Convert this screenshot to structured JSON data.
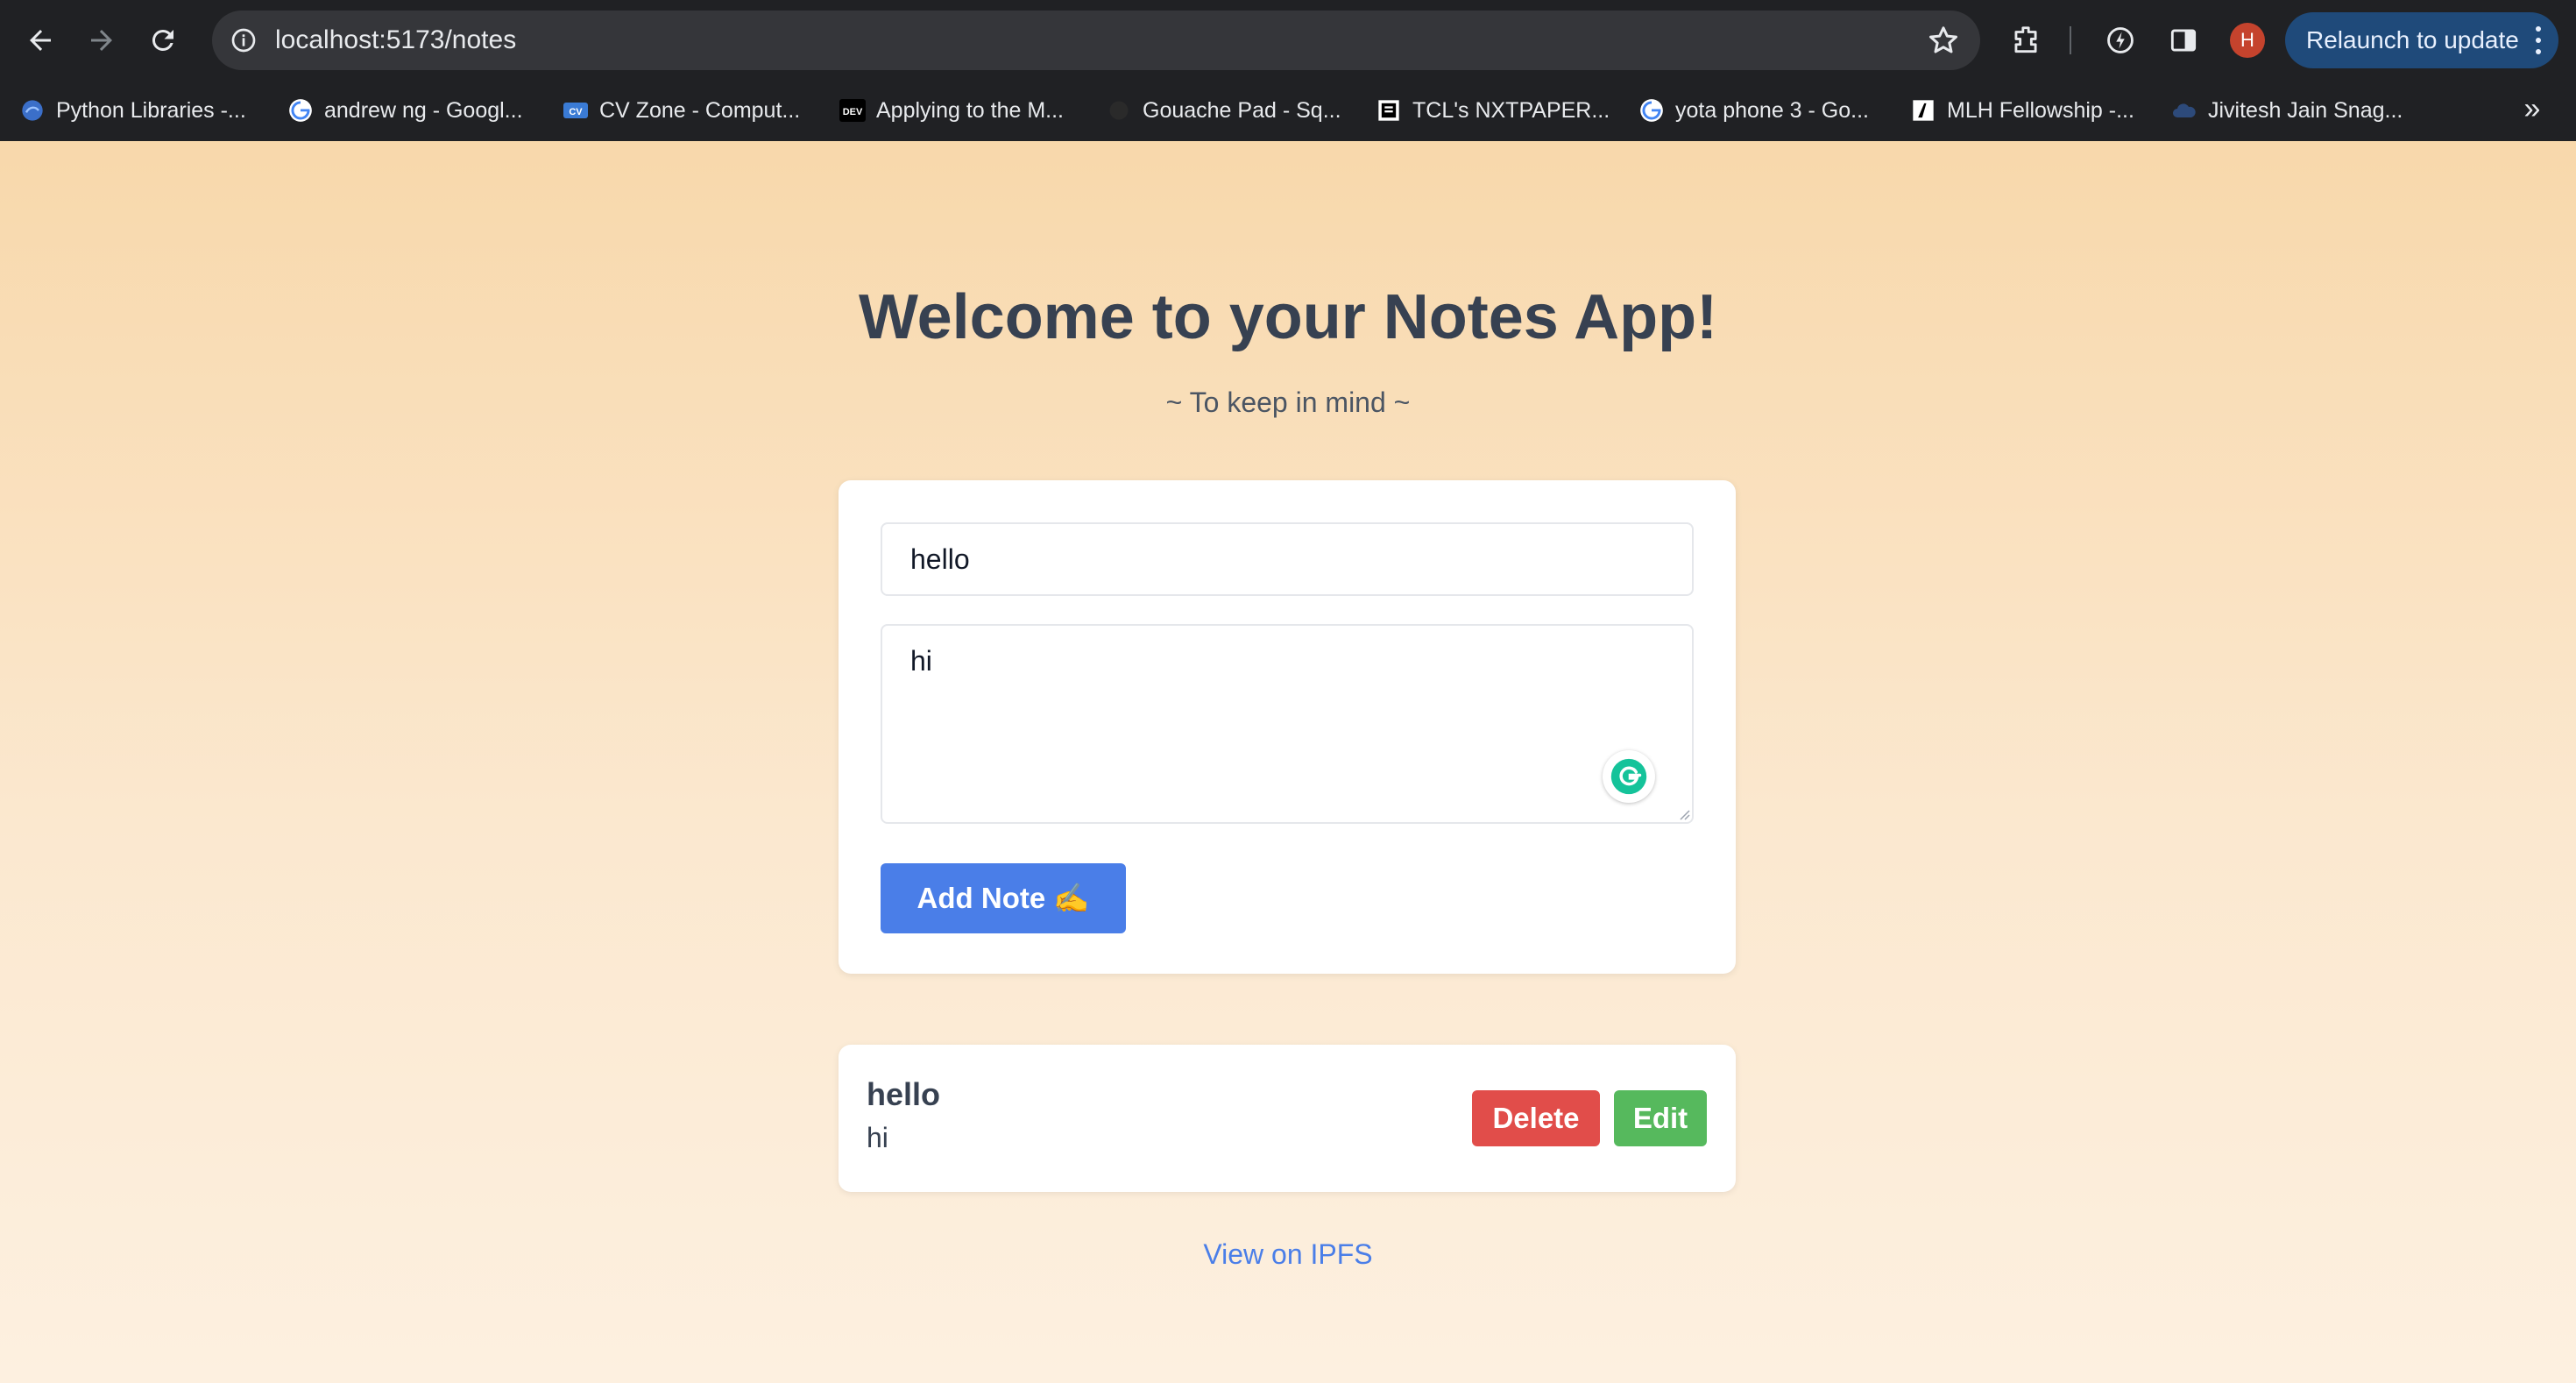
{
  "browser": {
    "url": "localhost:5173/notes",
    "relaunch_label": "Relaunch to update",
    "profile_initial": "H",
    "bookmarks": [
      {
        "label": "Python Libraries -...",
        "icon": "python-libraries-icon"
      },
      {
        "label": "andrew ng - Googl...",
        "icon": "google-icon"
      },
      {
        "label": "CV Zone - Comput...",
        "icon": "cvzone-icon"
      },
      {
        "label": "Applying to the M...",
        "icon": "dev-icon"
      },
      {
        "label": "Gouache Pad - Sq...",
        "icon": "gouache-icon"
      },
      {
        "label": "TCL's NXTPAPER...",
        "icon": "tcl-icon"
      },
      {
        "label": "yota phone 3 - Go...",
        "icon": "google-icon"
      },
      {
        "label": "MLH Fellowship -...",
        "icon": "mlh-icon"
      },
      {
        "label": "Jivitesh Jain Snag...",
        "icon": "cloud-icon"
      }
    ],
    "dev_icon_text": "DEV",
    "overflow_glyph": "»"
  },
  "page": {
    "title": "Welcome to your Notes App!",
    "subtitle": "~ To keep in mind ~"
  },
  "form": {
    "title_value": "hello",
    "body_value": "hi",
    "add_button_label": "Add Note ✍️"
  },
  "notes": [
    {
      "title": "hello",
      "body": "hi",
      "delete_label": "Delete",
      "edit_label": "Edit"
    }
  ],
  "footer": {
    "ipfs_link_label": "View on IPFS"
  },
  "colors": {
    "accent_blue": "#4a7ee8",
    "delete_red": "#e14d4a",
    "edit_green": "#56b95d",
    "grammarly_green": "#15c39a"
  }
}
